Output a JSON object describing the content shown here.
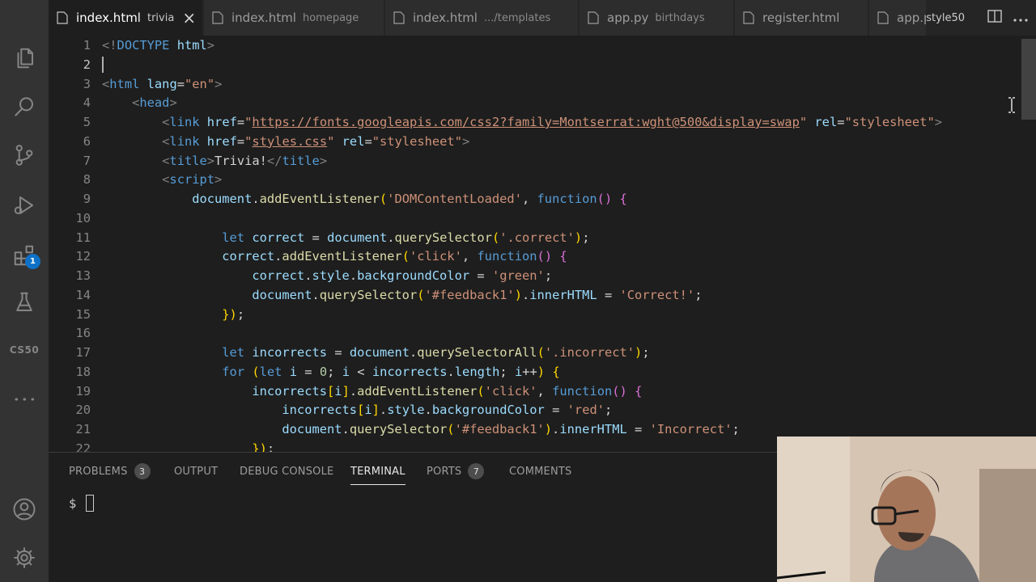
{
  "activity_bar": {
    "items": [
      {
        "icon": "files-icon"
      },
      {
        "icon": "search-icon"
      },
      {
        "icon": "source-control-icon"
      },
      {
        "icon": "run-debug-icon"
      },
      {
        "icon": "extensions-icon",
        "badge": "1"
      },
      {
        "icon": "testing-icon"
      },
      {
        "icon": "cs50-icon",
        "label": "CS50"
      },
      {
        "icon": "more-icon"
      }
    ],
    "bottom": [
      {
        "icon": "account-icon"
      },
      {
        "icon": "settings-gear-icon"
      }
    ]
  },
  "tabs": [
    {
      "name": "index.html",
      "desc": "trivia",
      "active": true
    },
    {
      "name": "index.html",
      "desc": "homepage"
    },
    {
      "name": "index.html",
      "desc": ".../templates"
    },
    {
      "name": "app.py",
      "desc": "birthdays"
    },
    {
      "name": "register.html",
      "desc": ""
    },
    {
      "name": "app.py",
      "desc": ""
    }
  ],
  "tab_actions": {
    "label": "style50"
  },
  "editor": {
    "current_line": 2,
    "line_numbers": [
      "1",
      "2",
      "3",
      "4",
      "5",
      "6",
      "7",
      "8",
      "9",
      "10",
      "11",
      "12",
      "13",
      "14",
      "15",
      "16",
      "17",
      "18",
      "19",
      "20",
      "21",
      "22"
    ],
    "lines": [
      "<!DOCTYPE html>",
      "",
      "<html lang=\"en\">",
      "    <head>",
      "        <link href=\"https://fonts.googleapis.com/css2?family=Montserrat:wght@500&display=swap\" rel=\"stylesheet\">",
      "        <link href=\"styles.css\" rel=\"stylesheet\">",
      "        <title>Trivia!</title>",
      "        <script>",
      "            document.addEventListener('DOMContentLoaded', function() {",
      "",
      "                let correct = document.querySelector('.correct');",
      "                correct.addEventListener('click', function() {",
      "                    correct.style.backgroundColor = 'green';",
      "                    document.querySelector('#feedback1').innerHTML = 'Correct!';",
      "                });",
      "",
      "                let incorrects = document.querySelectorAll('.incorrect');",
      "                for (let i = 0; i < incorrects.length; i++) {",
      "                    incorrects[i].addEventListener('click', function() {",
      "                        incorrects[i].style.backgroundColor = 'red';",
      "                        document.querySelector('#feedback1').innerHTML = 'Incorrect';",
      "                    });"
    ]
  },
  "panel": {
    "tabs": [
      {
        "label": "PROBLEMS",
        "count": "3"
      },
      {
        "label": "OUTPUT"
      },
      {
        "label": "DEBUG CONSOLE"
      },
      {
        "label": "TERMINAL",
        "active": true
      },
      {
        "label": "PORTS",
        "count": "7"
      },
      {
        "label": "COMMENTS"
      }
    ],
    "terminal_prompt": "$"
  },
  "colors": {
    "activity_bar": "#333333",
    "editor_bg": "#1e1e1e",
    "tab_inactive": "#2d2d2d",
    "badge": "#0e71c8"
  }
}
